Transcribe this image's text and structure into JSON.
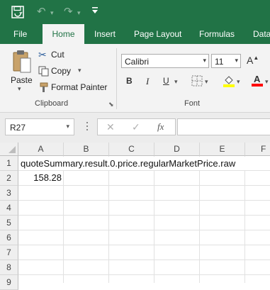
{
  "quick_access": {
    "save_icon": "save-icon",
    "undo_icon": "undo-icon",
    "redo_icon": "redo-icon",
    "customize_icon": "customize-qat-icon"
  },
  "ribbon_tabs": [
    "File",
    "Home",
    "Insert",
    "Page Layout",
    "Formulas",
    "Data"
  ],
  "active_tab": "Home",
  "clipboard": {
    "paste_label": "Paste",
    "cut_label": "Cut",
    "copy_label": "Copy",
    "format_painter_label": "Format Painter",
    "group_label": "Clipboard"
  },
  "font": {
    "font_name": "Calibri",
    "font_size": "11",
    "bold": "B",
    "italic": "I",
    "underline": "U",
    "group_label": "Font"
  },
  "formula_bar": {
    "name_box": "R27",
    "cancel_icon": "✕",
    "enter_icon": "✓",
    "fx_label": "fx",
    "formula": ""
  },
  "sheet": {
    "columns": [
      "A",
      "B",
      "C",
      "D",
      "E",
      "F"
    ],
    "rows": [
      "1",
      "2",
      "3",
      "4",
      "5",
      "6",
      "7",
      "8",
      "9"
    ],
    "cells": {
      "A1": "quoteSummary.result.0.price.regularMarketPrice.raw",
      "A2": "158.28"
    }
  },
  "colors": {
    "brand_green": "#217346",
    "ribbon_bg": "#f3f3f3"
  }
}
